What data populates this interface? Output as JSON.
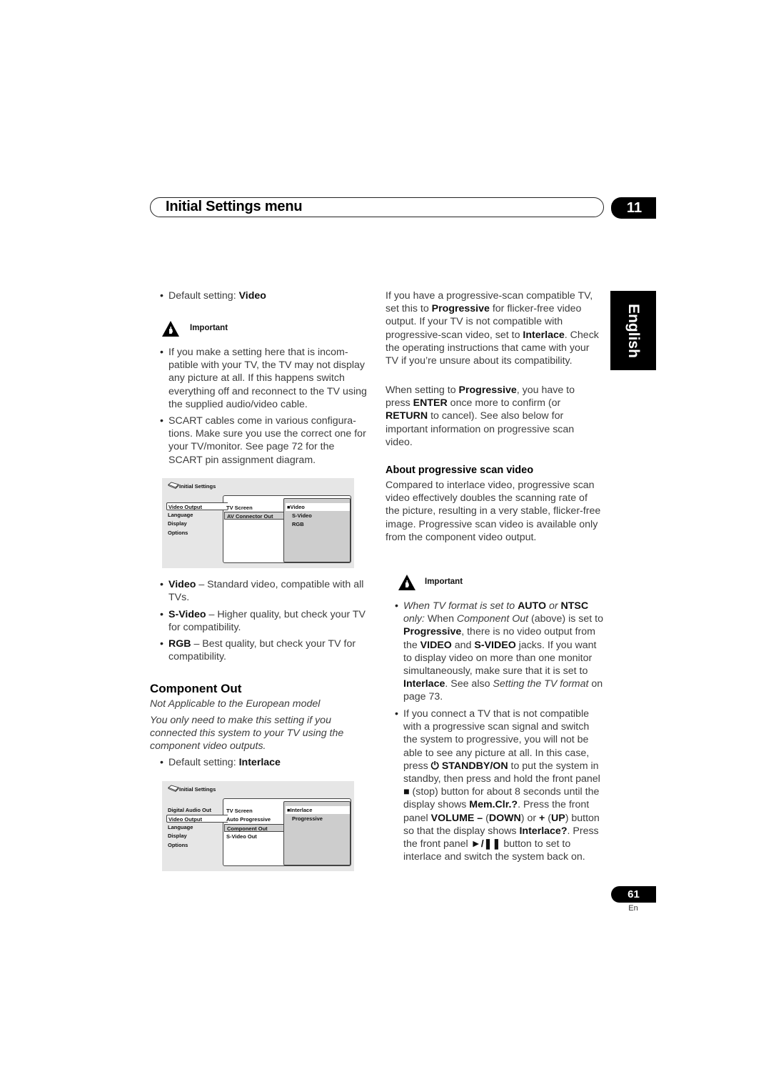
{
  "header": {
    "title": "Initial Settings menu",
    "chapter": "11",
    "language_tab": "English"
  },
  "left": {
    "default_video": {
      "prefix": "Default setting: ",
      "value": "Video"
    },
    "important_label": "Important",
    "important_bullets": [
      "If you make a setting here that is incom-patible with your TV, the TV may not display any picture at all. If this happens switch everything off and reconnect to the TV using the supplied audio/video cable.",
      "SCART cables come in various configura-tions. Make sure you use the correct one for your TV/monitor. See page 72 for the SCART pin assignment diagram."
    ],
    "menu1": {
      "title": "Initial Settings",
      "left_items": [
        "Video Output",
        "Language",
        "Display",
        "Options"
      ],
      "left_selected": "Video Output",
      "mid_items": [
        "TV Screen",
        "AV Connector Out"
      ],
      "mid_selected": "AV Connector Out",
      "options": [
        "Video",
        "S-Video",
        "RGB"
      ],
      "option_selected": "Video",
      "option_marker": "■"
    },
    "option_bullets": [
      {
        "term": "Video",
        "desc": " – Standard video, compatible with all TVs."
      },
      {
        "term": "S-Video",
        "desc": " – Higher quality, but check your TV for compatibility."
      },
      {
        "term": "RGB",
        "desc": " – Best quality, but check your TV for compatibility."
      }
    ],
    "component_heading": "Component Out",
    "component_note": "Not Applicable to the European model",
    "component_intro": "You only need to make this setting if you connected this system to your TV using the component video outputs.",
    "default_interlace": {
      "prefix": "Default setting: ",
      "value": "Interlace"
    },
    "menu2": {
      "title": "Initial Settings",
      "left_items": [
        "Digital Audio Out",
        "Video Output",
        "Language",
        "Display",
        "Options"
      ],
      "left_selected": "Video Output",
      "mid_items": [
        "TV Screen",
        "Auto Progressive",
        "Component Out",
        "S-Video Out"
      ],
      "mid_selected": "Component Out",
      "options": [
        "Interlace",
        "Progressive"
      ],
      "option_selected": "Interlace",
      "option_marker": "■"
    }
  },
  "right": {
    "p1": {
      "a": "If you have a progressive-scan compatible TV, set this to ",
      "b1": "Progressive",
      "c": " for flicker-free video output. If your TV is not compatible with progressive-scan video, set to ",
      "b2": "Interlace",
      "d": ". Check the operating instructions that came with your TV if you’re unsure about its compatibility."
    },
    "p2": {
      "a": "When setting to ",
      "b1": "Progressive",
      "c": ", you have to press ",
      "b2": "ENTER",
      "d": " once more to confirm (or ",
      "b3": "RETURN",
      "e": " to cancel). See also below for important information on progressive scan video."
    },
    "about_heading": "About progressive scan video",
    "about_text": "Compared to interlace video, progressive scan video effectively doubles the scanning rate of the picture, resulting in a very stable, flicker-free image. Progressive scan video is available only from the component video output.",
    "important_label": "Important",
    "bullet1": {
      "i1": "When TV format is set to ",
      "b1": "AUTO",
      "i2": " or ",
      "b2": "NTSC",
      "i3": " only:",
      "t1": " When ",
      "i4": "Component Out",
      "t2": " (above) is set to ",
      "b3": "Progressive",
      "t3": ", there is no video output from the ",
      "b4": "VIDEO",
      "t4": " and ",
      "b5": "S-VIDEO",
      "t5": " jacks. If you want to display video on more than one monitor simultaneously, make sure that it is set to ",
      "b6": "Interlace",
      "t6": ". See also ",
      "i5": "Setting the TV format",
      "t7": " on page 73."
    },
    "bullet2": {
      "t1": "If you connect a TV that is not compatible with a progressive scan signal and switch the system to progressive, you will not be able to see any picture at all. In this case, press ",
      "power_glyph": "⏻",
      "b1": " STANDBY/ON",
      "t2": " to put the system in standby, then press and hold the front panel ",
      "stop_glyph": "■",
      "t3": " (stop) button for about 8 seconds until the display shows ",
      "b2": "Mem.Clr.?",
      "t4": ". Press the front panel ",
      "b3": "VOLUME –",
      "t5": " (",
      "b4": "DOWN",
      "t6": ") or ",
      "b5": "+",
      "t7": " (",
      "b6": "UP",
      "t8": ")  button so that the display shows ",
      "b7": "Interlace?",
      "t9": ". Press the front panel ",
      "b8": "►/❚❚",
      "t10": " button to set to interlace and switch the system back on."
    }
  },
  "footer": {
    "page_number": "61",
    "lang_code": "En"
  }
}
